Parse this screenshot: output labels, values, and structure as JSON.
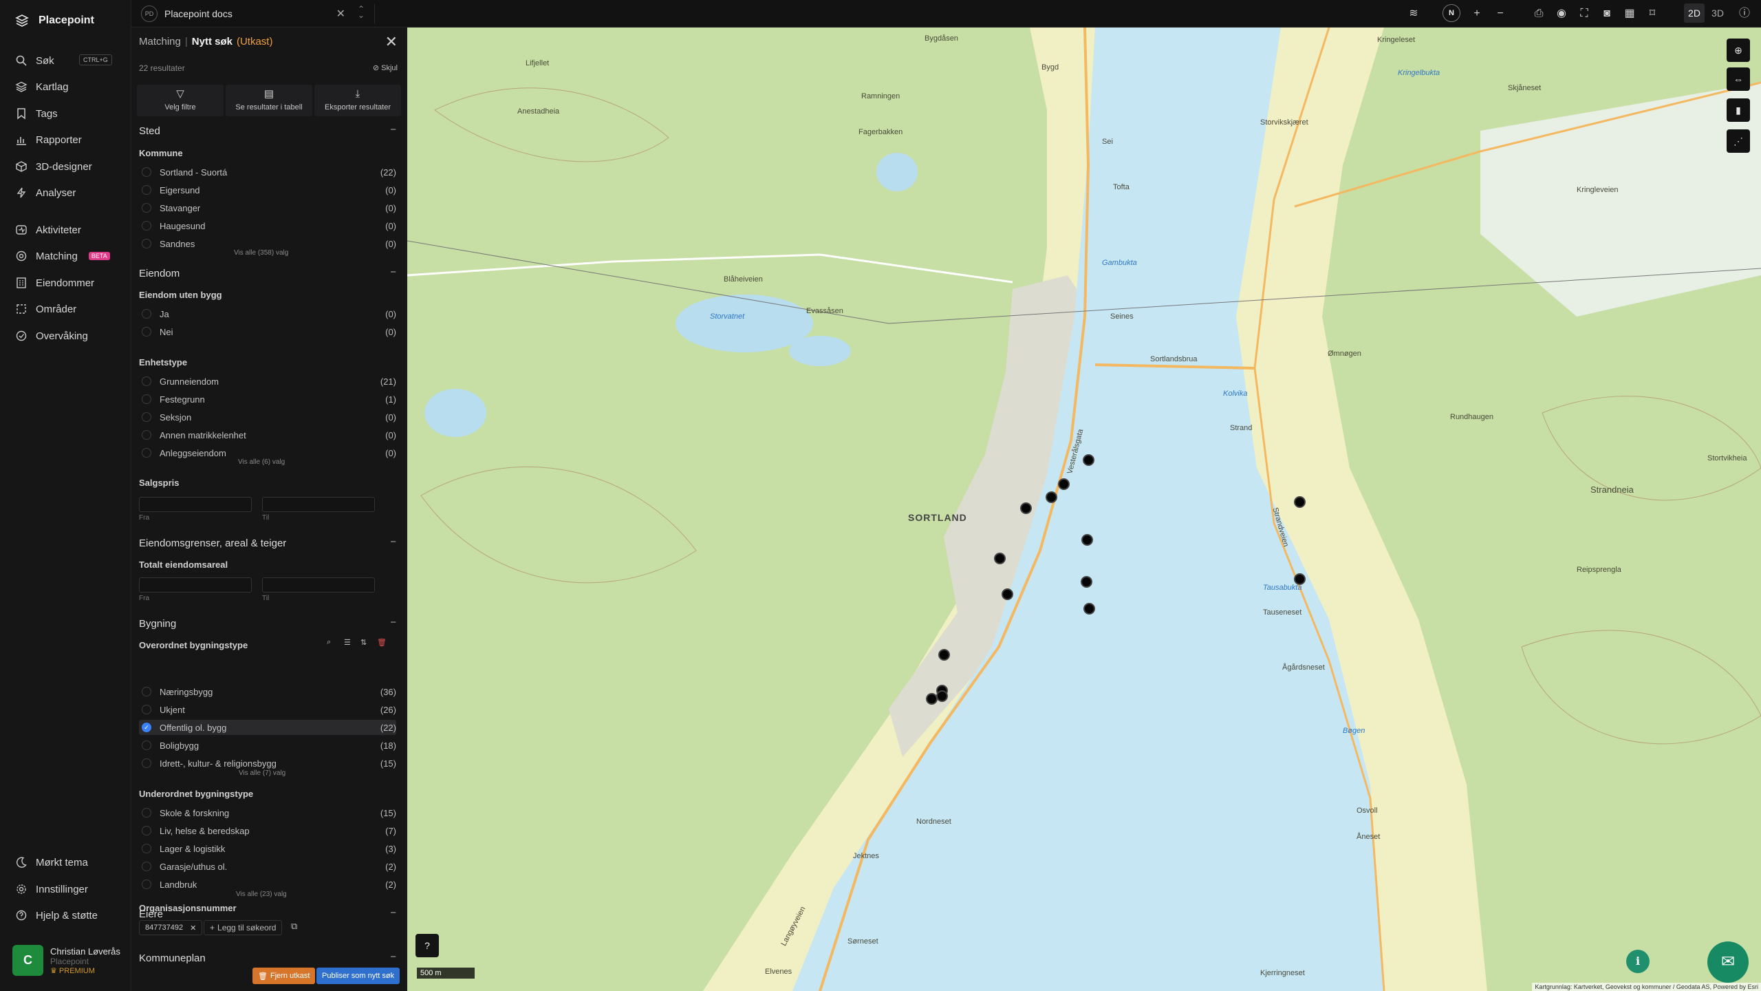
{
  "app": {
    "name": "Placepoint"
  },
  "sidebar": {
    "items": [
      {
        "label": "Søk",
        "icon": "search-icon"
      },
      {
        "label": "Kartlag",
        "icon": "layers-icon"
      },
      {
        "label": "Tags",
        "icon": "bookmark-icon"
      },
      {
        "label": "Rapporter",
        "icon": "chart-icon"
      },
      {
        "label": "3D-designer",
        "icon": "cube-icon"
      },
      {
        "label": "Analyser",
        "icon": "bolt-icon"
      },
      {
        "label": "Aktiviteter",
        "icon": "activity-icon"
      },
      {
        "label": "Matching",
        "icon": "target-icon"
      },
      {
        "label": "Eiendommer",
        "icon": "building-icon"
      },
      {
        "label": "Områder",
        "icon": "area-icon"
      },
      {
        "label": "Overvåking",
        "icon": "monitor-icon"
      }
    ],
    "search_shortcut": "CTRL+G",
    "matching_badge": "BETA",
    "bottom_items": [
      {
        "label": "Mørkt tema",
        "icon": "moon-icon"
      },
      {
        "label": "Innstillinger",
        "icon": "gear-icon"
      },
      {
        "label": "Hjelp & støtte",
        "icon": "help-icon"
      }
    ],
    "user": {
      "initial": "C",
      "name": "Christian Løverås",
      "org": "Placepoint",
      "plan": "PREMIUM"
    }
  },
  "topbar": {
    "tab_badge": "PD",
    "tab_label": "Placepoint docs",
    "north": "N",
    "view_2d": "2D",
    "view_3d": "3D"
  },
  "panel": {
    "breadcrumb_parent": "Matching",
    "breadcrumb_current": "Nytt søk",
    "breadcrumb_status": "(Utkast)",
    "results": "22 resultater",
    "hide": "Skjul",
    "actions": {
      "filters": "Velg filtre",
      "table": "Se resultater i tabell",
      "export": "Eksporter resultater"
    },
    "sted": {
      "title": "Sted",
      "kommune_title": "Kommune",
      "kommune": [
        {
          "label": "Sortland - Suortá",
          "count": "(22)"
        },
        {
          "label": "Eigersund",
          "count": "(0)"
        },
        {
          "label": "Stavanger",
          "count": "(0)"
        },
        {
          "label": "Haugesund",
          "count": "(0)"
        },
        {
          "label": "Sandnes",
          "count": "(0)"
        }
      ],
      "kommune_see_all": "Vis alle (358) valg"
    },
    "eiendom": {
      "title": "Eiendom",
      "uten_bygg_title": "Eiendom uten bygg",
      "uten_bygg": [
        {
          "label": "Ja",
          "count": "(0)"
        },
        {
          "label": "Nei",
          "count": "(0)"
        }
      ],
      "enhetstype_title": "Enhetstype",
      "enhetstype": [
        {
          "label": "Grunneiendom",
          "count": "(21)"
        },
        {
          "label": "Festegrunn",
          "count": "(1)"
        },
        {
          "label": "Seksjon",
          "count": "(0)"
        },
        {
          "label": "Annen matrikkelenhet",
          "count": "(0)"
        },
        {
          "label": "Anleggseiendom",
          "count": "(0)"
        }
      ],
      "enhetstype_see_all": "Vis alle (6) valg",
      "salgspris_title": "Salgspris",
      "from": "Fra",
      "to": "Til"
    },
    "grenser": {
      "title": "Eiendomsgrenser, areal & teiger",
      "areal_title": "Totalt eiendomsareal",
      "from": "Fra",
      "to": "Til"
    },
    "bygning": {
      "title": "Bygning",
      "overordnet_title": "Overordnet bygningstype",
      "overordnet": [
        {
          "label": "Næringsbygg",
          "count": "(36)"
        },
        {
          "label": "Ukjent",
          "count": "(26)"
        },
        {
          "label": "Offentlig ol. bygg",
          "count": "(22)"
        },
        {
          "label": "Boligbygg",
          "count": "(18)"
        },
        {
          "label": "Idrett-, kultur- & religionsbygg",
          "count": "(15)"
        }
      ],
      "overordnet_see_all": "Vis alle (7) valg",
      "underordnet_title": "Underordnet bygningstype",
      "underordnet": [
        {
          "label": "Skole & forskning",
          "count": "(15)"
        },
        {
          "label": "Liv, helse & beredskap",
          "count": "(7)"
        },
        {
          "label": "Lager & logistikk",
          "count": "(3)"
        },
        {
          "label": "Garasje/uthus ol.",
          "count": "(2)"
        },
        {
          "label": "Landbruk",
          "count": "(2)"
        }
      ],
      "underordnet_see_all": "Vis alle (23) valg"
    },
    "eiere": {
      "title": "Eiere",
      "org_title": "Organisasjonsnummer",
      "org_value": "847737492",
      "add_keyword": "Legg til søkeord"
    },
    "kommuneplan": {
      "title": "Kommuneplan"
    },
    "remove_draft": "Fjern utkast",
    "publish": "Publiser som nytt søk"
  },
  "map": {
    "labels": [
      {
        "text": "Bygdåsen",
        "water": false
      },
      {
        "text": "Kringeleset",
        "water": false
      },
      {
        "text": "Kringelbukta",
        "water": true
      },
      {
        "text": "Skjåneset",
        "water": false
      },
      {
        "text": "Storvikskjæret",
        "water": false
      },
      {
        "text": "Kringleveien",
        "water": false
      },
      {
        "text": "Lifjellet",
        "water": false
      },
      {
        "text": "Anestadheia",
        "water": false
      },
      {
        "text": "Bygd",
        "water": false
      },
      {
        "text": "Ramningen",
        "water": false
      },
      {
        "text": "Fagerbakken",
        "water": false
      },
      {
        "text": "Sei",
        "water": false
      },
      {
        "text": "Tofta",
        "water": false
      },
      {
        "text": "Blåheiveien",
        "water": false
      },
      {
        "text": "Storvatnet",
        "water": true
      },
      {
        "text": "Evassåsen",
        "water": false
      },
      {
        "text": "Seines",
        "water": false
      },
      {
        "text": "Gambukta",
        "water": true
      },
      {
        "text": "Sortlandsbrua",
        "water": false
      },
      {
        "text": "Kolvika",
        "water": true
      },
      {
        "text": "Strand",
        "water": false
      },
      {
        "text": "Ømnøgen",
        "water": false
      },
      {
        "text": "SORTLAND",
        "water": false
      },
      {
        "text": "Strandveien",
        "water": false
      },
      {
        "text": "Strandneia",
        "water": false
      },
      {
        "text": "Vesterålsgata",
        "water": false
      },
      {
        "text": "Tausabukta",
        "water": true
      },
      {
        "text": "Tauseneset",
        "water": false
      },
      {
        "text": "Ågårdsneset",
        "water": false
      },
      {
        "text": "Bøgen",
        "water": true
      },
      {
        "text": "Nordneset",
        "water": false
      },
      {
        "text": "Jektnes",
        "water": false
      },
      {
        "text": "Langøyveien",
        "water": false
      },
      {
        "text": "Sørneset",
        "water": false
      },
      {
        "text": "Elvenes",
        "water": false
      },
      {
        "text": "Kjerringneset",
        "water": false
      },
      {
        "text": "Osvoll",
        "water": false
      },
      {
        "text": "Åneset",
        "water": false
      },
      {
        "text": "Rundhaugen",
        "water": false
      },
      {
        "text": "Reipsprengla",
        "water": false
      },
      {
        "text": "Stortvikheia",
        "water": false
      }
    ],
    "scale": "500 m",
    "help": "?",
    "info": "i",
    "attribution": "Kartgrunnlag: Kartverket, Geovekst og kommuner / Geodata AS, Powered by Esri"
  }
}
